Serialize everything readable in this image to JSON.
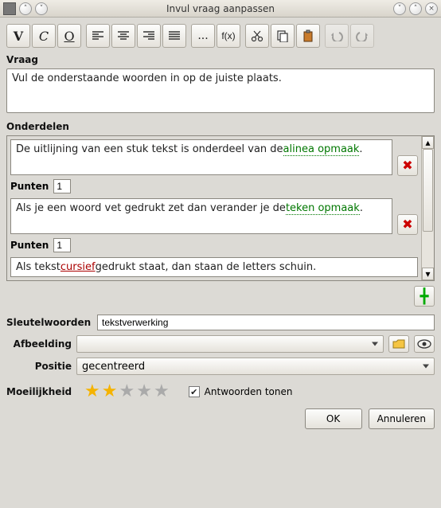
{
  "window": {
    "title": "Invul vraag aanpassen"
  },
  "toolbar": {
    "bold": "V",
    "italic": "C",
    "underline": "O",
    "fx": "f(x)",
    "dots": "..."
  },
  "labels": {
    "vraag": "Vraag",
    "onderdelen": "Onderdelen",
    "punten": "Punten",
    "sleutelwoorden": "Sleutelwoorden",
    "afbeelding": "Afbeelding",
    "positie": "Positie",
    "moeilijkheid": "Moeilijkheid",
    "antwoorden_tonen": "Antwoorden tonen"
  },
  "question": "Vul de onderstaande woorden in op de juiste plaats.",
  "parts": [
    {
      "prefix": "De uitlijning van een stuk tekst is onderdeel van de ",
      "blank": "alinea opmaak",
      "suffix": ".",
      "points": "1"
    },
    {
      "prefix": "Als je een woord vet gedrukt zet dan verander je de ",
      "blank": "teken opmaak",
      "suffix": ".",
      "points": "1"
    },
    {
      "prefix": "Als tekst ",
      "mis": "cursief",
      "mid": " gedrukt staat, dan staan de letters schuin.",
      "blank": "",
      "suffix": ""
    }
  ],
  "keywords": "tekstverwerking",
  "image": {
    "value": "",
    "position": "gecentreerd"
  },
  "difficulty": {
    "filled": 2,
    "total": 5
  },
  "show_answers": true,
  "buttons": {
    "ok": "OK",
    "cancel": "Annuleren"
  }
}
